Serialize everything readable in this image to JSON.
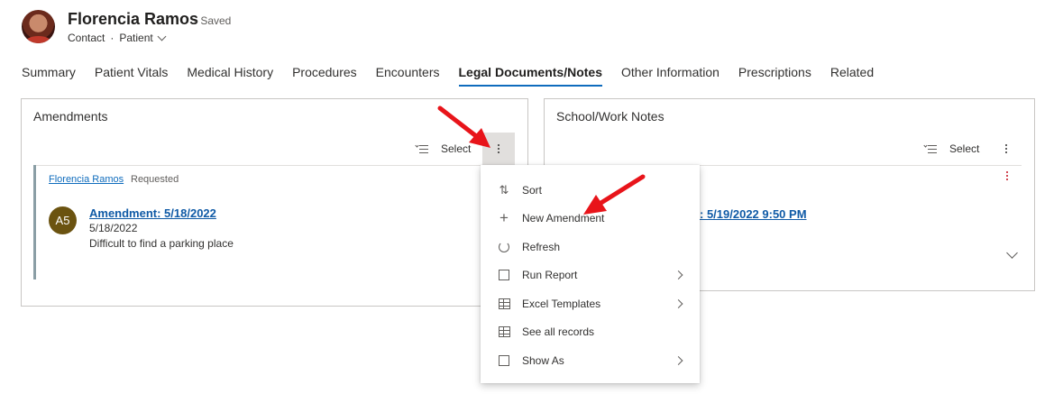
{
  "record": {
    "name": "Florencia Ramos",
    "saved_status": "- Saved",
    "entity": "Contact",
    "separator": "·",
    "form": "Patient"
  },
  "tabs": [
    {
      "label": "Summary"
    },
    {
      "label": "Patient Vitals"
    },
    {
      "label": "Medical History"
    },
    {
      "label": "Procedures"
    },
    {
      "label": "Encounters"
    },
    {
      "label": "Legal Documents/Notes",
      "active": true
    },
    {
      "label": "Other Information"
    },
    {
      "label": "Prescriptions"
    },
    {
      "label": "Related"
    }
  ],
  "amendments": {
    "title": "Amendments",
    "select_label": "Select",
    "item": {
      "requester": "Florencia Ramos",
      "status": "Requested",
      "initials": "A5",
      "title": "Amendment: 5/18/2022",
      "date": "5/18/2022",
      "description": "Difficult to find a parking place"
    }
  },
  "notes": {
    "title": "School/Work Notes",
    "select_label": "Select",
    "partial_link": ": 5/19/2022 9:50 PM"
  },
  "menu": {
    "items": [
      {
        "label": "Sort",
        "icon": "sort-icon",
        "submenu": false
      },
      {
        "label": "New Amendment",
        "icon": "plus-icon",
        "submenu": false
      },
      {
        "label": "Refresh",
        "icon": "refresh-icon",
        "submenu": false
      },
      {
        "label": "Run Report",
        "icon": "report-icon",
        "submenu": true
      },
      {
        "label": "Excel Templates",
        "icon": "excel-icon",
        "submenu": true
      },
      {
        "label": "See all records",
        "icon": "grid-icon",
        "submenu": false
      },
      {
        "label": "Show As",
        "icon": "show-as-icon",
        "submenu": true
      }
    ]
  },
  "colors": {
    "accent": "#0f6cbd",
    "link": "#0f5aa6",
    "avatar_initials_bg": "#6b5310",
    "annotation_arrow": "#e8141a"
  }
}
